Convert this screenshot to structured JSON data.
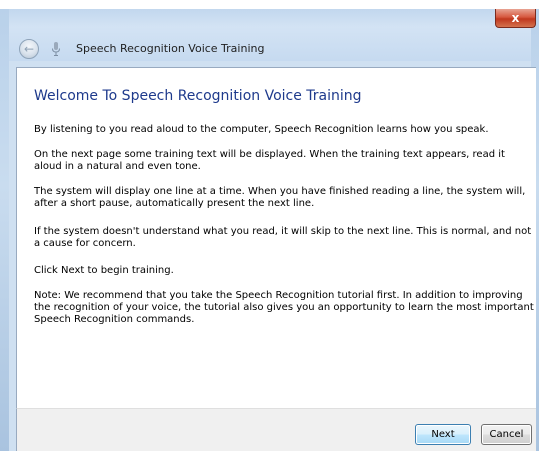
{
  "window": {
    "title": "Speech Recognition Voice Training",
    "close_glyph": "x"
  },
  "icons": {
    "back": "back-arrow-icon",
    "title": "microphone-icon",
    "close": "close-icon"
  },
  "content": {
    "heading": "Welcome To Speech Recognition Voice Training",
    "paragraphs": [
      "By listening to you read aloud to the computer, Speech Recognition learns how you speak.",
      "On the next page some training text will be displayed. When the training text appears, read it aloud in a natural and even tone.",
      "The system will display one line at a time. When you have finished reading a line, the system will, after a short pause, automatically present the next line.",
      "If the system doesn't understand what you read, it will skip to the next line. This is normal, and not a cause for concern.",
      "Click Next to begin training.",
      "Note: We recommend that you take the Speech Recognition tutorial first. In addition to improving the recognition of your voice, the tutorial also gives you an opportunity to learn the most important Speech Recognition commands."
    ]
  },
  "footer": {
    "next_label": "Next",
    "cancel_label": "Cancel"
  },
  "colors": {
    "heading": "#1e3a8c",
    "frame": "#c6daf0",
    "close_button": "#c7452c",
    "next_button_border": "#3c7fb1"
  }
}
